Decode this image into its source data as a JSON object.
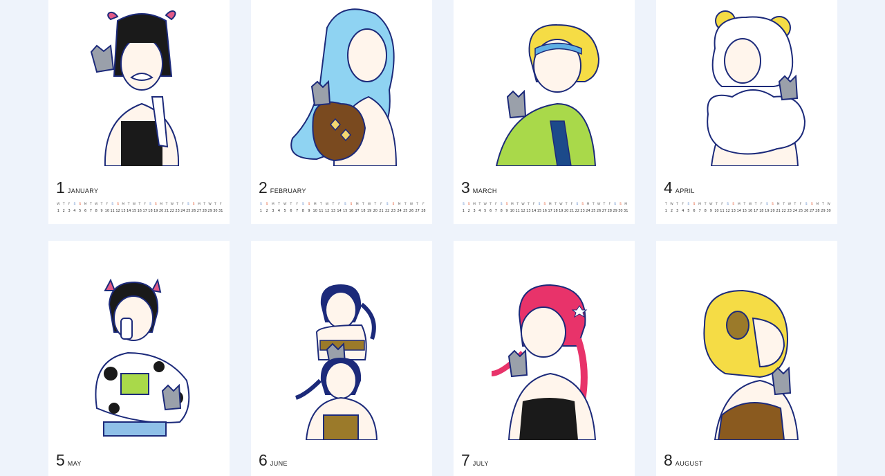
{
  "colors": {
    "background": "#eef3fb",
    "card": "#ffffff",
    "outline": "#1c2a7a",
    "cat": "#9aa0aa",
    "skin": "#fff5ec"
  },
  "months": [
    {
      "number": "1",
      "name": "JANUARY",
      "weekday_start": 3,
      "days": 31,
      "image": "girl with goat horns and cat"
    },
    {
      "number": "2",
      "name": "FEBRUARY",
      "weekday_start": 6,
      "days": 28,
      "image": "girl with blue hair holding urn and cat"
    },
    {
      "number": "3",
      "name": "MARCH",
      "weekday_start": 6,
      "days": 31,
      "image": "girl with yellow hair in green hoodie and cat"
    },
    {
      "number": "4",
      "name": "APRIL",
      "weekday_start": 2,
      "days": 30,
      "image": "girl with ram horns and wool and cat"
    },
    {
      "number": "5",
      "name": "MAY",
      "image": "girl with bull horns in cow print jacket and cat"
    },
    {
      "number": "6",
      "name": "JUNE",
      "image": "twin girls with feathers and cat"
    },
    {
      "number": "7",
      "name": "JULY",
      "image": "girl with red braids holding cat"
    },
    {
      "number": "8",
      "name": "AUGUST",
      "image": "girl with yellow lion mane and cat"
    }
  ]
}
